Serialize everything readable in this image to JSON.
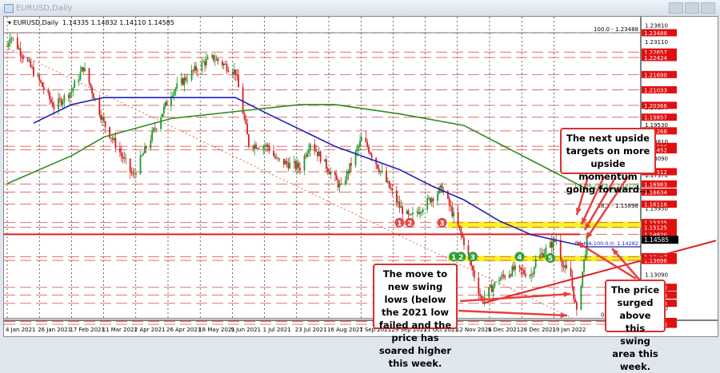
{
  "window": {
    "title": "EURUSD,Daily"
  },
  "header": {
    "symbol": "EURUSD,Daily",
    "ohlc": "1.14335 1.14832 1.14110 1.14585"
  },
  "annotations": {
    "upside": "The next upside targets on more upside momentum going forward...",
    "swing_lows": "The move to new swing lows (below the 2021 low failed and the price has soared higher this week.",
    "surged": "The price surged above this swing area this week."
  },
  "colors": {
    "up": "#1a9a2a",
    "down": "#d42020",
    "ma100": "#1f1fb8",
    "ma200": "#2e8b1e",
    "level": "#d94040",
    "yellow": "#f5f000"
  },
  "chart_data": {
    "type": "candlestick",
    "title": "EURUSD,Daily",
    "ylim": [
      1.107,
      1.24
    ],
    "x_ticks": [
      "4 Jan 2021",
      "26 Jan 2021",
      "17 Feb 2021",
      "11 Mar 2021",
      "2 Apr 2021",
      "26 Apr 2021",
      "18 May 2021",
      "9 Jun 2021",
      "1 Jul 2021",
      "23 Jul 2021",
      "16 Aug 2021",
      "7 Sep 2021",
      "29 Sep 2021",
      "21 Oct 2021",
      "12 Nov 2021",
      "6 Dec 2021",
      "28 Dec 2021",
      "19 Jan 2022"
    ],
    "y_ticks": [
      "1.23810",
      "1.23110",
      "1.22400",
      "1.21690",
      "1.20990",
      "1.20290",
      "1.19530",
      "1.18810",
      "1.18090",
      "1.17370",
      "1.16650",
      "1.15950",
      "1.15230",
      "1.13090",
      "1.12370",
      "1.11650",
      "1.10950"
    ],
    "price_anchors": [
      [
        "2021-01-04",
        1.229
      ],
      [
        "2021-01-06",
        1.234
      ],
      [
        "2021-01-26",
        1.214
      ],
      [
        "2021-02-05",
        1.203
      ],
      [
        "2021-02-17",
        1.21
      ],
      [
        "2021-02-25",
        1.22
      ],
      [
        "2021-03-11",
        1.196
      ],
      [
        "2021-03-31",
        1.173
      ],
      [
        "2021-04-02",
        1.176
      ],
      [
        "2021-04-26",
        1.209
      ],
      [
        "2021-05-07",
        1.216
      ],
      [
        "2021-05-18",
        1.222
      ],
      [
        "2021-05-25",
        1.224
      ],
      [
        "2021-06-09",
        1.218
      ],
      [
        "2021-06-18",
        1.187
      ],
      [
        "2021-07-01",
        1.186
      ],
      [
        "2021-07-07",
        1.18
      ],
      [
        "2021-07-23",
        1.177
      ],
      [
        "2021-07-30",
        1.188
      ],
      [
        "2021-08-20",
        1.168
      ],
      [
        "2021-09-03",
        1.189
      ],
      [
        "2021-09-07",
        1.186
      ],
      [
        "2021-09-29",
        1.16
      ],
      [
        "2021-10-06",
        1.155
      ],
      [
        "2021-10-21",
        1.164
      ],
      [
        "2021-10-28",
        1.168
      ],
      [
        "2021-11-05",
        1.156
      ],
      [
        "2021-11-12",
        1.145
      ],
      [
        "2021-11-24",
        1.12
      ],
      [
        "2021-12-06",
        1.129
      ],
      [
        "2021-12-16",
        1.133
      ],
      [
        "2021-12-28",
        1.131
      ],
      [
        "2021-12-31",
        1.137
      ],
      [
        "2022-01-14",
        1.146
      ],
      [
        "2022-01-19",
        1.134
      ],
      [
        "2022-01-24",
        1.13
      ],
      [
        "2022-01-28",
        1.114
      ],
      [
        "2022-02-04",
        1.14585
      ]
    ],
    "series": [
      {
        "name": "D1 MA:100:0:0",
        "points": [
          [
            "2021-01-22",
            1.196
          ],
          [
            "2021-02-17",
            1.204
          ],
          [
            "2021-03-11",
            1.207
          ],
          [
            "2021-04-26",
            1.207
          ],
          [
            "2021-06-09",
            1.207
          ],
          [
            "2021-07-01",
            1.2
          ],
          [
            "2021-08-16",
            1.186
          ],
          [
            "2021-09-29",
            1.176
          ],
          [
            "2021-10-21",
            1.169
          ],
          [
            "2021-11-12",
            1.163
          ],
          [
            "2021-12-06",
            1.154
          ],
          [
            "2021-12-28",
            1.148
          ],
          [
            "2022-02-04",
            1.14282
          ]
        ]
      },
      {
        "name": "D1 MA:200:0:0",
        "points": [
          [
            "2021-01-04",
            1.17
          ],
          [
            "2021-02-17",
            1.182
          ],
          [
            "2021-03-11",
            1.19
          ],
          [
            "2021-04-26",
            1.198
          ],
          [
            "2021-06-09",
            1.201
          ],
          [
            "2021-07-23",
            1.204
          ],
          [
            "2021-08-16",
            1.204
          ],
          [
            "2021-09-29",
            1.2
          ],
          [
            "2021-11-12",
            1.195
          ],
          [
            "2021-12-28",
            1.18
          ],
          [
            "2022-02-04",
            1.1677
          ]
        ]
      }
    ],
    "levels_red": [
      "1.23488",
      "1.22657",
      "1.22424",
      "1.21690",
      "1.21033",
      "1.20366",
      "1.19857",
      "1.19268",
      "1.18600",
      "1.18452",
      "1.17512",
      "1.16983",
      "1.16634",
      "1.16116",
      "1.15325",
      "1.15125",
      "1.14820",
      "1.13857",
      "1.13696",
      "1.12540",
      "1.12208",
      "1.11853",
      "1.11071",
      "1.10950"
    ],
    "current_price": "1.14585",
    "fib_labels": [
      [
        "100.0 - 1.23488",
        1.23488
      ],
      [
        "61.8 - 1.18797",
        1.18797
      ],
      [
        "50.0 - 1.17347",
        1.17347
      ],
      [
        "38.2 - 1.15898",
        1.15898
      ],
      [
        "0.0 - 1.11207",
        1.11207
      ]
    ],
    "ma_labels": [
      [
        "D1 MA:200:0:0: 1.16770",
        1.1677
      ],
      [
        "D1 MA:100:0:0: 1.14282",
        1.14282
      ]
    ],
    "yellow_zones": [
      [
        1.15125,
        1.15325
      ],
      [
        1.13696,
        1.13857
      ]
    ],
    "markers": [
      {
        "label": "1",
        "color": "red",
        "date": "2021-09-29",
        "price": 1.1532
      },
      {
        "label": "2",
        "color": "red",
        "date": "2021-10-06",
        "price": 1.1532
      },
      {
        "label": "3",
        "color": "red",
        "date": "2021-10-28",
        "price": 1.1532
      },
      {
        "label": "1",
        "color": "green",
        "date": "2021-11-05",
        "price": 1.1386
      },
      {
        "label": "2",
        "color": "green",
        "date": "2021-11-10",
        "price": 1.1386
      },
      {
        "label": "3",
        "color": "green",
        "date": "2021-11-18",
        "price": 1.1386
      },
      {
        "label": "4",
        "color": "green",
        "date": "2021-12-20",
        "price": 1.1386
      },
      {
        "label": "5",
        "color": "green",
        "date": "2022-01-10",
        "price": 1.138
      }
    ]
  }
}
